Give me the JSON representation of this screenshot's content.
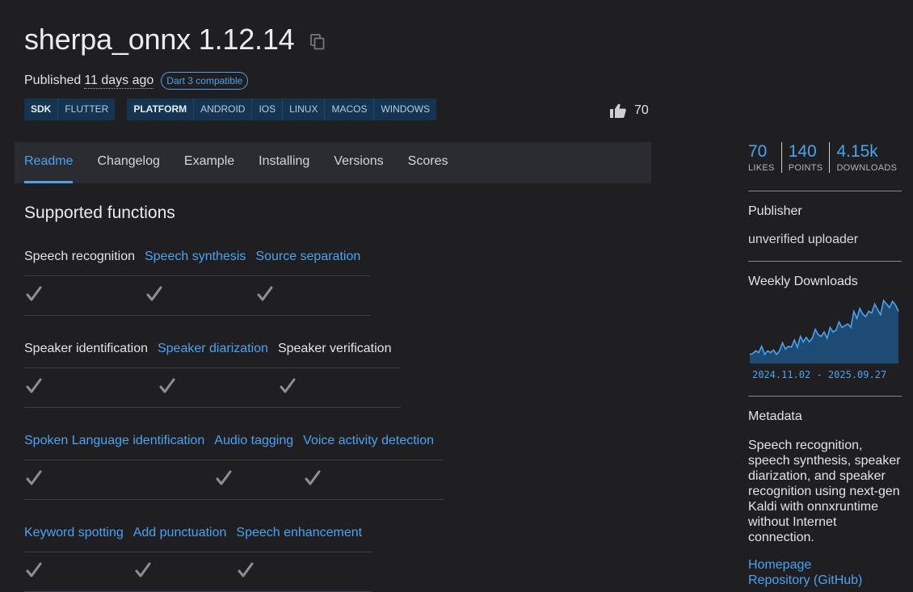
{
  "package": {
    "name_version": "sherpa_onnx 1.12.14"
  },
  "published": {
    "label": "Published",
    "date": "11 days ago",
    "badge": "Dart 3 compatible"
  },
  "tags": [
    {
      "items": [
        "SDK",
        "FLUTTER"
      ]
    },
    {
      "items": [
        "PLATFORM",
        "ANDROID",
        "IOS",
        "LINUX",
        "MACOS",
        "WINDOWS"
      ]
    }
  ],
  "likes_top": "70",
  "tabs": [
    "Readme",
    "Changelog",
    "Example",
    "Installing",
    "Versions",
    "Scores"
  ],
  "active_tab": "Readme",
  "readme": {
    "section_title": "Supported functions",
    "tables": [
      {
        "headers": [
          {
            "text": "Speech recognition",
            "link": false
          },
          {
            "text": "Speech synthesis",
            "link": true
          },
          {
            "text": "Source separation",
            "link": true
          }
        ]
      },
      {
        "headers": [
          {
            "text": "Speaker identification",
            "link": false
          },
          {
            "text": "Speaker diarization",
            "link": true
          },
          {
            "text": "Speaker verification",
            "link": false
          }
        ]
      },
      {
        "headers": [
          {
            "text": "Spoken Language identification",
            "link": true
          },
          {
            "text": "Audio tagging",
            "link": true
          },
          {
            "text": "Voice activity detection",
            "link": true
          }
        ]
      },
      {
        "headers": [
          {
            "text": "Keyword spotting",
            "link": true
          },
          {
            "text": "Add punctuation",
            "link": true
          },
          {
            "text": "Speech enhancement",
            "link": true
          }
        ]
      }
    ],
    "check_mark": "✔"
  },
  "sidebar": {
    "stats": [
      {
        "value": "70",
        "label": "LIKES"
      },
      {
        "value": "140",
        "label": "POINTS"
      },
      {
        "value": "4.15k",
        "label": "DOWNLOADS"
      }
    ],
    "publisher_heading": "Publisher",
    "publisher_value": "unverified uploader",
    "weekly_heading": "Weekly Downloads",
    "weekly_range": "2024.11.02 - 2025.09.27",
    "weekly_series": [
      10,
      11,
      14,
      12,
      19,
      10,
      14,
      12,
      15,
      10,
      14,
      23,
      16,
      19,
      18,
      26,
      18,
      30,
      24,
      29,
      24,
      28,
      38,
      32,
      30,
      35,
      28,
      40,
      35,
      37,
      46,
      40,
      42,
      44,
      40,
      58,
      50,
      61,
      55,
      52,
      58,
      56,
      66,
      60,
      54,
      70,
      66,
      62,
      69,
      65,
      58
    ],
    "metadata_heading": "Metadata",
    "metadata_text": "Speech recognition, speech synthesis, speaker diarization, and speaker recognition using next-gen Kaldi with onnxruntime without Internet connection.",
    "links": [
      "Homepage",
      "Repository (GitHub)"
    ]
  },
  "colors": {
    "accent": "#4aa3ef",
    "background": "#1f1f22",
    "tag_bg": "#143452",
    "tabs_bg": "#2a2c31"
  }
}
